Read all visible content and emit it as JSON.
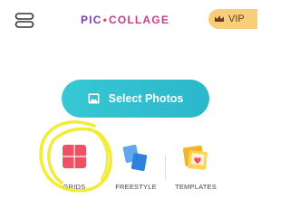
{
  "header": {
    "logo_left": "PIC",
    "logo_dot": "•",
    "logo_right": "COLLAGE",
    "vip_label": "VIP"
  },
  "main": {
    "select_photos_label": "Select Photos"
  },
  "options": [
    {
      "label": "GRIDS"
    },
    {
      "label": "FREESTYLE"
    },
    {
      "label": "TEMPLATES"
    }
  ],
  "colors": {
    "accent": "#33c2d0",
    "vip": "#f7cf7b",
    "grids": "#ee5064",
    "freestyle": "#3d8ce6",
    "templates": "#f5b428",
    "highlight": "#f2ea2a"
  },
  "icons": {
    "menu": "menu-icon",
    "vip": "crown-icon",
    "select_photos": "photo-icon",
    "grids": "grid-icon",
    "freestyle": "freestyle-icon",
    "templates": "template-icon"
  }
}
